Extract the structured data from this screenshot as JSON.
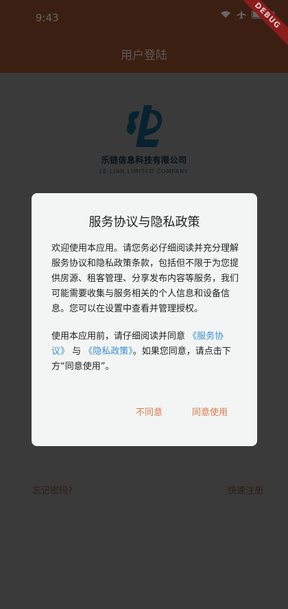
{
  "status_bar": {
    "time": "9:43",
    "battery_partial": "1"
  },
  "app_bar": {
    "title": "用户登陆"
  },
  "debug_banner": "DEBUG",
  "company": {
    "name_cn": "乐链信息科技有限公司",
    "name_en": "LE LIAN LIMITED COMPANY"
  },
  "links": {
    "forgot_password": "忘记密码?",
    "quick_register": "快速注册"
  },
  "dialog": {
    "title": "服务协议与隐私政策",
    "paragraph1": "欢迎使用本应用。请您务必仔细阅读并充分理解服务协议和隐私政策条款，包括但不限于为您提供房源、租客管理、分享发布内容等服务，我们可能需要收集与服务相关的个人信息和设备信息。您可以在设置中查看并管理授权。",
    "paragraph2_prefix": "使用本应用前，请仔细阅读并同意 ",
    "link_service": "《服务协议》",
    "paragraph2_and": " 与 ",
    "link_privacy": "《隐私政策》",
    "paragraph2_suffix": "。如果您同意，请点击下方“同意使用”。",
    "disagree_label": "不同意",
    "agree_label": "同意使用"
  },
  "colors": {
    "app_bar": "#6b3a22",
    "dialog_bg": "#f3f5f4",
    "action_text": "#d87a4a",
    "link_text": "#3b8fd6",
    "logo_primary": "#0f3f57"
  }
}
